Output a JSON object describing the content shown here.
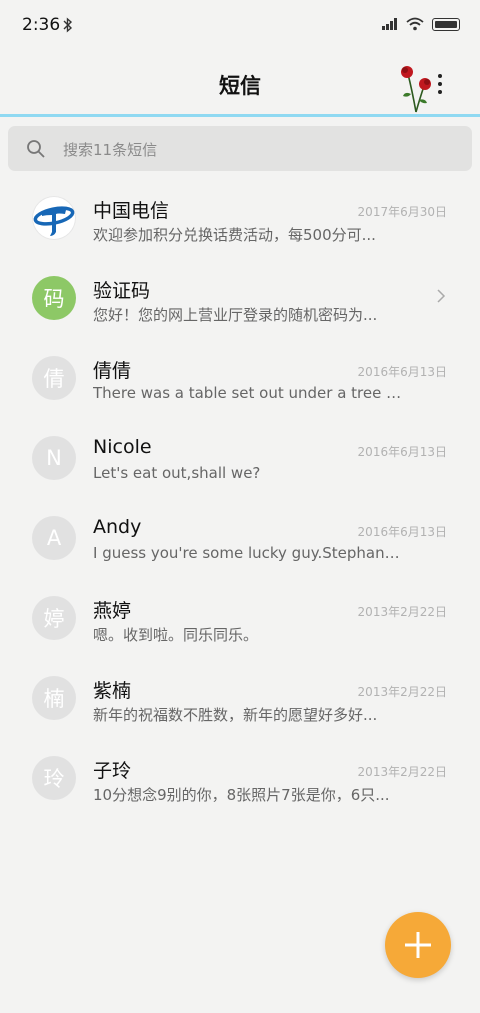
{
  "status_bar": {
    "time": "2:36"
  },
  "header": {
    "title": "短信"
  },
  "search": {
    "placeholder": "搜索11条短信"
  },
  "conversations": [
    {
      "name": "中国电信",
      "date": "2017年6月30日",
      "preview": "欢迎参加积分兑换话费活动，每500分可...",
      "avatar": ""
    },
    {
      "name": "验证码",
      "date": "",
      "preview": "您好！您的网上营业厅登录的随机密码为...",
      "avatar": "码"
    },
    {
      "name": "倩倩",
      "date": "2016年6月13日",
      "preview": "There was a table set out under a tree i...",
      "avatar": "倩"
    },
    {
      "name": "Nicole",
      "date": "2016年6月13日",
      "preview": "Let's eat out,shall we?",
      "avatar": "N"
    },
    {
      "name": "Andy",
      "date": "2016年6月13日",
      "preview": "I guess you're some lucky guy.Stephani...",
      "avatar": "A"
    },
    {
      "name": "燕婷",
      "date": "2013年2月22日",
      "preview": "嗯。收到啦。同乐同乐。",
      "avatar": "婷"
    },
    {
      "name": "紫楠",
      "date": "2013年2月22日",
      "preview": "新年的祝福数不胜数，新年的愿望好多好...",
      "avatar": "楠"
    },
    {
      "name": "子玲",
      "date": "2013年2月22日",
      "preview": "10分想念9别的你，8张照片7张是你，6只...",
      "avatar": "玲"
    }
  ],
  "colors": {
    "accent_line": "#8fd9f2",
    "fab": "#f6a938",
    "verify_avatar": "#8dc866",
    "telecom_blue": "#1767b6"
  }
}
